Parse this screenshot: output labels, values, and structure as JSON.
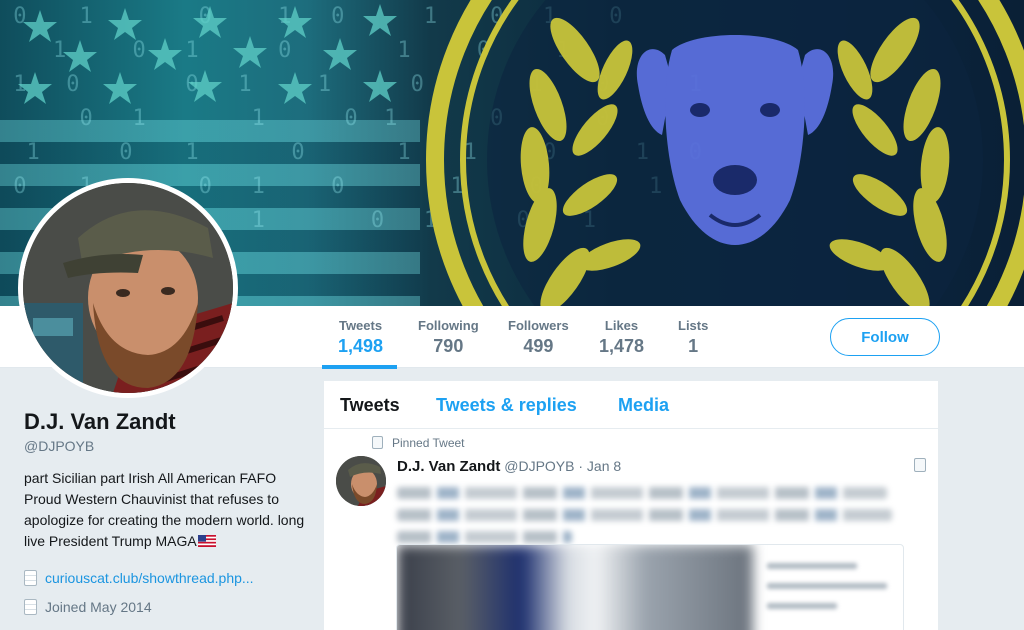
{
  "profile": {
    "name": "D.J. Van Zandt",
    "handle": "@DJPOYB",
    "bio": "part Sicilian part Irish All American FAFO Proud Western Chauvinist that refuses to apologize for creating the modern world. long live President Trump MAGA",
    "bio_flag_icon": "us-flag-icon",
    "website": "curiouscat.club/showthread.php...",
    "joined": "Joined May 2014"
  },
  "stats": {
    "tweets_label": "Tweets",
    "tweets_value": "1,498",
    "following_label": "Following",
    "following_value": "790",
    "followers_label": "Followers",
    "followers_value": "499",
    "likes_label": "Likes",
    "likes_value": "1,478",
    "lists_label": "Lists",
    "lists_value": "1"
  },
  "follow_label": "Follow",
  "tabs": [
    "Tweets",
    "Tweets & replies",
    "Media"
  ],
  "pinned_tweet": {
    "label": "Pinned Tweet",
    "name": "D.J. Van Zandt",
    "handle": "@DJPOYB",
    "date": "· Jan 8"
  },
  "colors": {
    "accent": "#1da1f2",
    "background": "#e6ecf0",
    "banner_gold": "#c9c43a",
    "banner_dog": "#6a7ff0"
  }
}
